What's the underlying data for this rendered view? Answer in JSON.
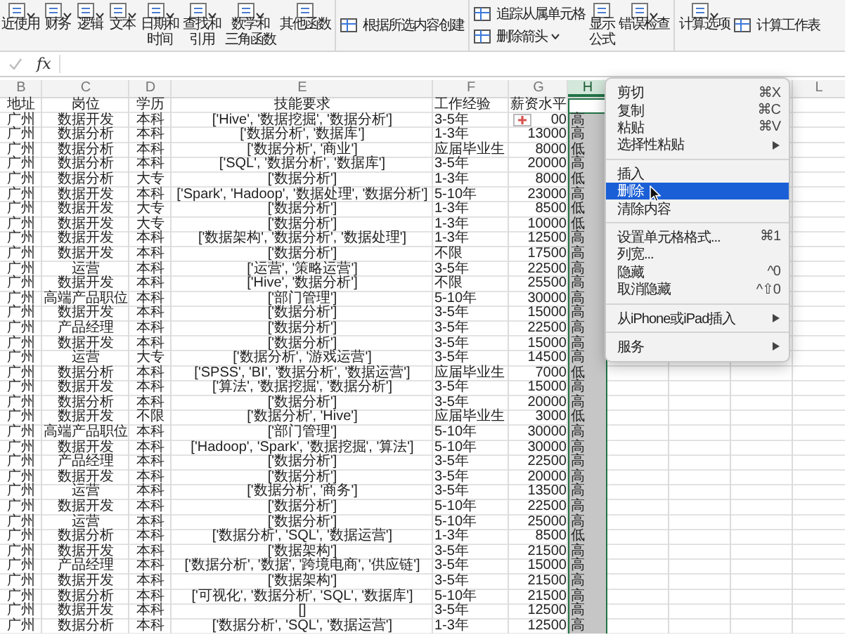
{
  "ribbon": {
    "groups": [
      {
        "items": [
          {
            "kind": "large",
            "label": "近使用",
            "dropdown": true
          },
          {
            "kind": "large",
            "label": "财务",
            "dropdown": true
          },
          {
            "kind": "large",
            "label": "逻辑",
            "dropdown": true
          },
          {
            "kind": "large",
            "label": "文本",
            "dropdown": true
          },
          {
            "kind": "large",
            "label": "日期和时间",
            "dropdown": true
          },
          {
            "kind": "large",
            "label": "查找和引用",
            "dropdown": true
          },
          {
            "kind": "large",
            "label": "数学和三角函数",
            "dropdown": true
          },
          {
            "kind": "large",
            "label": "其他函数",
            "dropdown": false
          }
        ]
      },
      {
        "items": [
          {
            "kind": "small",
            "label": "根据所选内容创建",
            "dropdown": false
          }
        ]
      },
      {
        "items": [
          {
            "kind": "small",
            "label": "追踪从属单元格",
            "dropdown": false
          },
          {
            "kind": "small",
            "label": "删除箭头",
            "dropdown": true
          },
          {
            "kind": "narrow",
            "label": "显示公式",
            "dropdown": false
          },
          {
            "kind": "large",
            "label": "错误检查",
            "dropdown": true
          }
        ]
      },
      {
        "items": [
          {
            "kind": "large",
            "label": "计算选项",
            "dropdown": true
          },
          {
            "kind": "small",
            "label": "计算工作表",
            "dropdown": false
          }
        ]
      }
    ]
  },
  "formula_bar": {
    "function_label": "fx"
  },
  "sheet": {
    "columns": [
      {
        "letter": "B",
        "selected": false
      },
      {
        "letter": "C",
        "selected": false
      },
      {
        "letter": "D",
        "selected": false
      },
      {
        "letter": "E",
        "selected": false
      },
      {
        "letter": "F",
        "selected": false
      },
      {
        "letter": "G",
        "selected": false
      },
      {
        "letter": "H",
        "selected": true
      },
      {
        "letter": "L",
        "selected": false
      }
    ],
    "header": [
      "地址",
      "岗位",
      "学历",
      "技能要求",
      "工作经验",
      "薪资水平"
    ],
    "rows": [
      [
        "广州",
        "数据开发",
        "本科",
        "['Hive', '数据挖掘', '数据分析']",
        "3-5年",
        "00",
        "高"
      ],
      [
        "广州",
        "数据分析",
        "本科",
        "['数据分析', '数据库']",
        "1-3年",
        "13000",
        "高"
      ],
      [
        "广州",
        "数据分析",
        "本科",
        "['数据分析', '商业']",
        "应届毕业生",
        "8000",
        "低"
      ],
      [
        "广州",
        "数据分析",
        "本科",
        "['SQL', '数据分析', '数据库']",
        "3-5年",
        "20000",
        "高"
      ],
      [
        "广州",
        "数据分析",
        "大专",
        "['数据分析']",
        "1-3年",
        "8000",
        "低"
      ],
      [
        "广州",
        "数据开发",
        "本科",
        "['Spark', 'Hadoop', '数据处理', '数据分析']",
        "5-10年",
        "23000",
        "高"
      ],
      [
        "广州",
        "数据开发",
        "大专",
        "['数据分析']",
        "1-3年",
        "8500",
        "低"
      ],
      [
        "广州",
        "数据开发",
        "大专",
        "['数据分析']",
        "1-3年",
        "10000",
        "低"
      ],
      [
        "广州",
        "数据开发",
        "本科",
        "['数据架构', '数据分析', '数据处理']",
        "1-3年",
        "12500",
        "高"
      ],
      [
        "广州",
        "数据开发",
        "本科",
        "['数据分析']",
        "不限",
        "17500",
        "高"
      ],
      [
        "广州",
        "运营",
        "本科",
        "['运营', '策略运营']",
        "3-5年",
        "22500",
        "高"
      ],
      [
        "广州",
        "数据开发",
        "本科",
        "['Hive', '数据分析']",
        "不限",
        "25500",
        "高"
      ],
      [
        "广州",
        "高端产品职位",
        "本科",
        "['部门管理']",
        "5-10年",
        "30000",
        "高"
      ],
      [
        "广州",
        "数据开发",
        "本科",
        "['数据分析']",
        "3-5年",
        "15000",
        "高"
      ],
      [
        "广州",
        "产品经理",
        "本科",
        "['数据分析']",
        "3-5年",
        "22500",
        "高"
      ],
      [
        "广州",
        "数据开发",
        "本科",
        "['数据分析']",
        "3-5年",
        "15000",
        "高"
      ],
      [
        "广州",
        "运营",
        "大专",
        "['数据分析', '游戏运营']",
        "3-5年",
        "14500",
        "高"
      ],
      [
        "广州",
        "数据分析",
        "本科",
        "['SPSS', 'BI', '数据分析', '数据运营']",
        "应届毕业生",
        "7000",
        "低"
      ],
      [
        "广州",
        "数据开发",
        "本科",
        "['算法', '数据挖掘', '数据分析']",
        "3-5年",
        "15000",
        "高"
      ],
      [
        "广州",
        "数据分析",
        "本科",
        "['数据分析']",
        "3-5年",
        "20000",
        "高"
      ],
      [
        "广州",
        "数据开发",
        "不限",
        "['数据分析', 'Hive']",
        "应届毕业生",
        "3000",
        "低"
      ],
      [
        "广州",
        "高端产品职位",
        "本科",
        "['部门管理']",
        "5-10年",
        "30000",
        "高"
      ],
      [
        "广州",
        "数据开发",
        "本科",
        "['Hadoop', 'Spark', '数据挖掘', '算法']",
        "5-10年",
        "30000",
        "高"
      ],
      [
        "广州",
        "产品经理",
        "本科",
        "['数据分析']",
        "3-5年",
        "22500",
        "高"
      ],
      [
        "广州",
        "数据开发",
        "本科",
        "['数据分析']",
        "3-5年",
        "20000",
        "高"
      ],
      [
        "广州",
        "运营",
        "本科",
        "['数据分析', '商务']",
        "3-5年",
        "13500",
        "高"
      ],
      [
        "广州",
        "数据开发",
        "本科",
        "['数据分析']",
        "5-10年",
        "22500",
        "高"
      ],
      [
        "广州",
        "运营",
        "本科",
        "['数据分析']",
        "5-10年",
        "25000",
        "高"
      ],
      [
        "广州",
        "数据分析",
        "本科",
        "['数据分析', 'SQL', '数据运营']",
        "1-3年",
        "8500",
        "低"
      ],
      [
        "广州",
        "数据开发",
        "本科",
        "['数据架构']",
        "3-5年",
        "21500",
        "高"
      ],
      [
        "广州",
        "产品经理",
        "本科",
        "['数据分析', '数据', '跨境电商', '供应链']",
        "3-5年",
        "15000",
        "高"
      ],
      [
        "广州",
        "数据开发",
        "本科",
        "['数据架构']",
        "3-5年",
        "21500",
        "高"
      ],
      [
        "广州",
        "数据分析",
        "本科",
        "['可视化', '数据分析', 'SQL', '数据库']",
        "5-10年",
        "21500",
        "高"
      ],
      [
        "广州",
        "数据开发",
        "本科",
        "[]",
        "3-5年",
        "12500",
        "高"
      ],
      [
        "广州",
        "数据分析",
        "本科",
        "['数据分析', 'SQL', '数据运营']",
        "1-3年",
        "12500",
        "高"
      ]
    ]
  },
  "context_menu": {
    "items": [
      {
        "kind": "item",
        "label": "剪切",
        "shortcut": "⌘X",
        "submenu": false,
        "selected": false
      },
      {
        "kind": "item",
        "label": "复制",
        "shortcut": "⌘C",
        "submenu": false,
        "selected": false
      },
      {
        "kind": "item",
        "label": "粘贴",
        "shortcut": "⌘V",
        "submenu": false,
        "selected": false
      },
      {
        "kind": "item",
        "label": "选择性粘贴",
        "submenu": true,
        "selected": false
      },
      {
        "kind": "separator"
      },
      {
        "kind": "item",
        "label": "插入",
        "submenu": false,
        "selected": false
      },
      {
        "kind": "item",
        "label": "删除",
        "submenu": false,
        "selected": true
      },
      {
        "kind": "item",
        "label": "清除内容",
        "submenu": false,
        "selected": false
      },
      {
        "kind": "separator"
      },
      {
        "kind": "item",
        "label": "设置单元格格式...",
        "shortcut": "⌘1",
        "submenu": false,
        "selected": false
      },
      {
        "kind": "item",
        "label": "列宽...",
        "submenu": false,
        "selected": false
      },
      {
        "kind": "item",
        "label": "隐藏",
        "shortcut": "^0",
        "submenu": false,
        "selected": false
      },
      {
        "kind": "item",
        "label": "取消隐藏",
        "shortcut": "^⇧0",
        "submenu": false,
        "selected": false
      },
      {
        "kind": "separator"
      },
      {
        "kind": "item",
        "label": "从iPhone或iPad插入",
        "submenu": true,
        "selected": false
      },
      {
        "kind": "separator"
      },
      {
        "kind": "item",
        "label": "服务",
        "submenu": true,
        "selected": false
      }
    ]
  }
}
